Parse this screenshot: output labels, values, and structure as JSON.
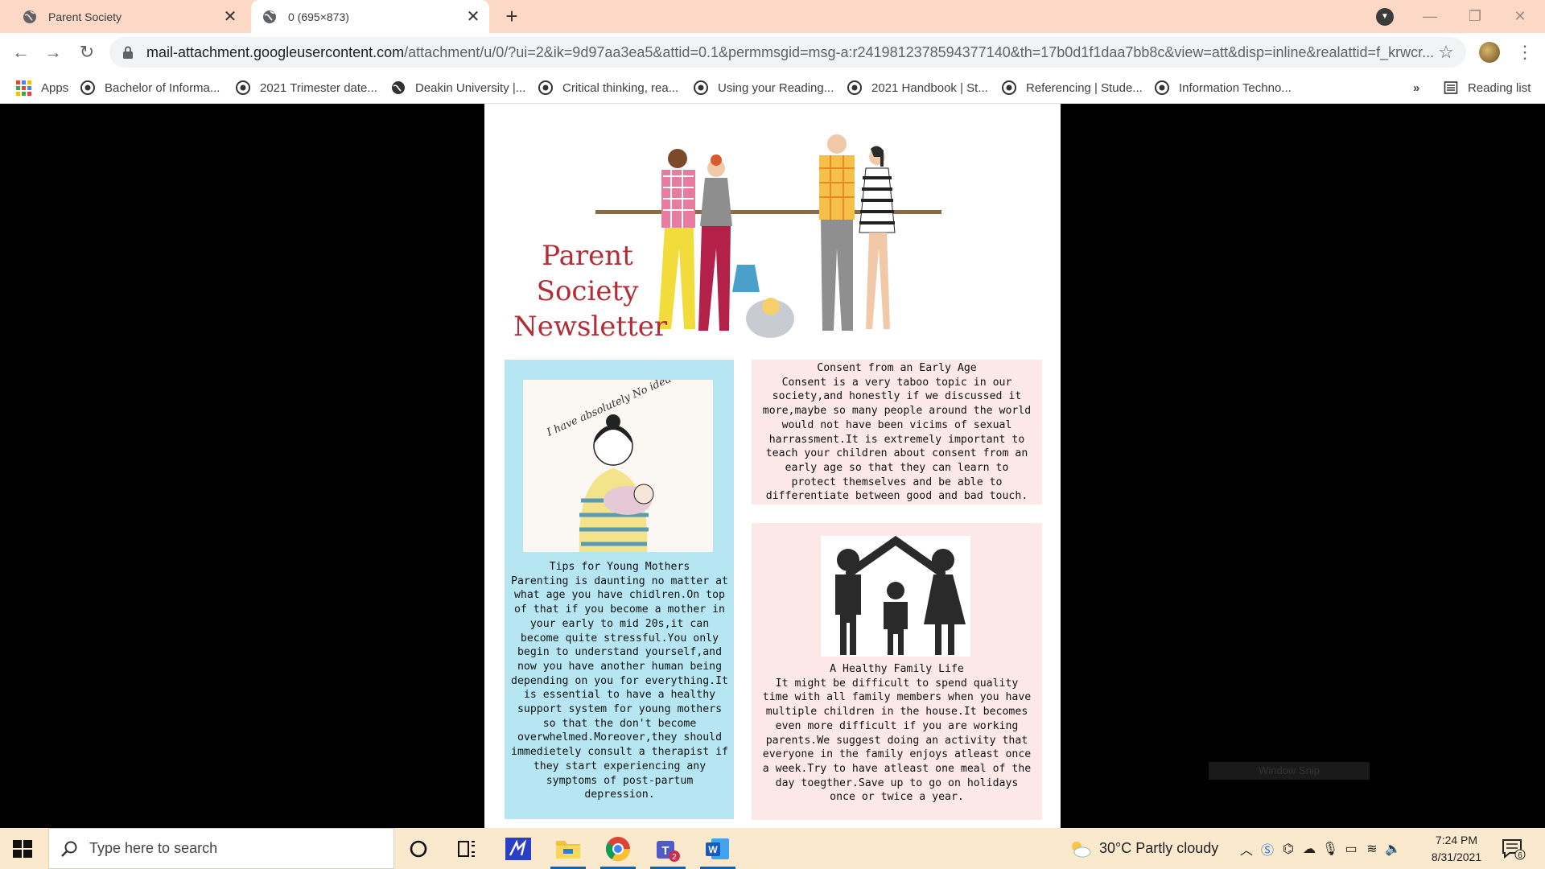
{
  "browser": {
    "tabs": [
      {
        "title": "Parent Society",
        "active": false
      },
      {
        "title": "0 (695×873)",
        "active": true
      }
    ],
    "url_host": "mail-attachment.googleusercontent.com",
    "url_rest": "/attachment/u/0/?ui=2&ik=9d97aa3ea5&attid=0.1&permmsgid=msg-a:r2419812378594377140&th=17b0d1f1daa7bb8c&view=att&disp=inline&realattid=f_krwcr...",
    "bookmarks": [
      "Apps",
      "Bachelor of Informa...",
      "2021 Trimester date...",
      "Deakin University |...",
      "Critical thinking, rea...",
      "Using your Reading...",
      "2021 Handbook | St...",
      "Referencing | Stude...",
      "Information Techno..."
    ],
    "more_bookmarks": "»",
    "reading_list": "Reading list"
  },
  "newsletter": {
    "title_lines": [
      "Parent",
      "Society",
      "Newsletter"
    ],
    "image_text": "I have absolutely No idea what I'm doing.",
    "articles": [
      {
        "title": "Tips for Young Mothers",
        "body": "Parenting is daunting no matter at what age you have chidlren.On top of that if you become a mother in your early to mid 20s,it can become quite stressful.You only begin to understand yourself,and now you have another human being depending on you for everything.It is essential to have a healthy support system for young mothers so that the don't become overwhelmed.Moreover,they should immedietely consult a therapist if they start experiencing any symptoms of post-partum depression."
      },
      {
        "title": "Consent from an Early Age",
        "body": "Consent is a very taboo topic in our society,and honestly if we discussed it more,maybe so many people around the world would not have been vicims of sexual harrassment.It is extremely important to teach your children about consent from an early age so that they can learn to protect themselves and be able to differentiate between good and bad touch."
      },
      {
        "title": "A Healthy Family Life",
        "body": "It might be difficult to spend quality time with all family members when you have multiple children in the house.It becomes even more difficult if you are working parents.We suggest doing an activity that everyone in the family enjoys atleast once a week.Try to have atleast one meal of the day toegther.Save up to go on holidays once or twice a year."
      }
    ]
  },
  "overlay": {
    "snip_hint": "Window Snip"
  },
  "taskbar": {
    "search_placeholder": "Type here to search",
    "weather": "30°C  Partly cloudy",
    "time": "7:24 PM",
    "date": "8/31/2021",
    "notification_count": "6",
    "teams_badge": "2"
  },
  "colors": {
    "tabstrip": "#fbd9c6",
    "title_red": "#b32d36",
    "card_blue": "#b5e6f2",
    "card_pink": "#fde8e8",
    "taskbar": "#fbe9cd"
  }
}
